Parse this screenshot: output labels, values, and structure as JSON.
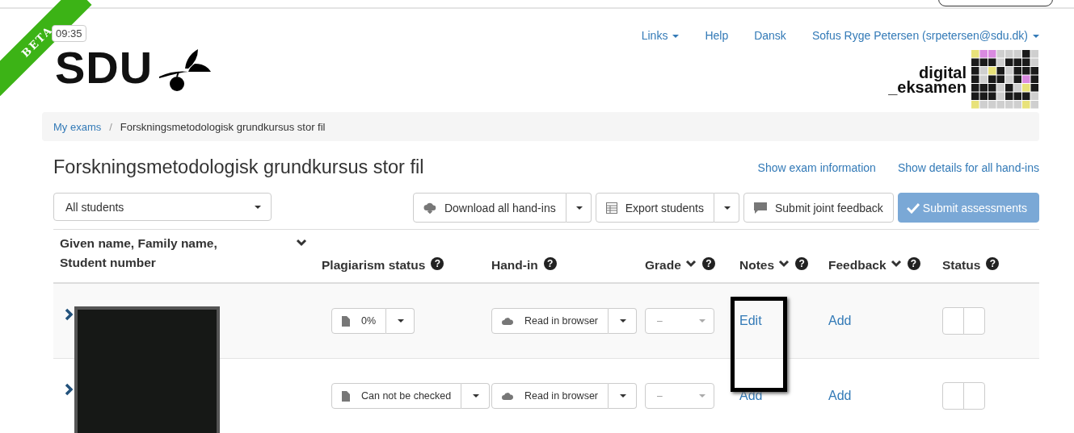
{
  "ribbon": "BETA",
  "clock": "09:35",
  "logo": "SDU",
  "nav": [
    {
      "label": "Links",
      "dropdown": true
    },
    {
      "label": "Help",
      "dropdown": false
    },
    {
      "label": "Dansk",
      "dropdown": false
    },
    {
      "label": "Sofus Ryge Petersen (srpetersen@sdu.dk)",
      "dropdown": true
    }
  ],
  "brand": {
    "line1": "digital",
    "line2": "_eksamen"
  },
  "breadcrumb": [
    {
      "label": "My exams",
      "link": true
    },
    {
      "separator": "/",
      "label": "Forskningsmetodologisk grundkursus stor fil",
      "link": false
    }
  ],
  "title": "Forskningsmetodologisk grundkursus stor fil",
  "header_links": [
    "Show exam information",
    "Show details for all hand-ins"
  ],
  "filter": {
    "value": "All students"
  },
  "toolbar": [
    {
      "kind": "split",
      "label": "Download all hand-ins",
      "disabled": false
    },
    {
      "kind": "split",
      "label": "Export students",
      "disabled": false
    },
    {
      "kind": "plain",
      "label": "Submit joint feedback",
      "disabled": false
    },
    {
      "kind": "primary",
      "label": "Submit assessments",
      "disabled": true
    }
  ],
  "columns": [
    {
      "label": "Given name, Family name, Student number",
      "sort": true
    },
    {
      "label": "Plagiarism status",
      "sort": false,
      "help_icon": "?"
    },
    {
      "label": "Hand-in",
      "sort": false,
      "help_icon": "?"
    },
    {
      "label": "Grade",
      "sort": true,
      "help_icon": "?"
    },
    {
      "label": "Notes",
      "sort": true,
      "help_icon": "?"
    },
    {
      "label": "Feedback",
      "sort": true,
      "help_icon": "?"
    },
    {
      "label": "Status",
      "sort": false,
      "help_icon": "?"
    }
  ],
  "rows": [
    {
      "plagiarism": "0%",
      "handin": "Read in browser",
      "grade": "–",
      "notes": "Edit",
      "feedback": "Add",
      "status": [
        {
          "selected": false
        },
        {
          "selected": false
        }
      ]
    },
    {
      "plagiarism": "Can not be checked",
      "handin": "Read in browser",
      "grade": "–",
      "notes": "Add",
      "feedback": "Add",
      "status": [
        {
          "selected": false
        },
        {
          "selected": false
        }
      ]
    }
  ]
}
